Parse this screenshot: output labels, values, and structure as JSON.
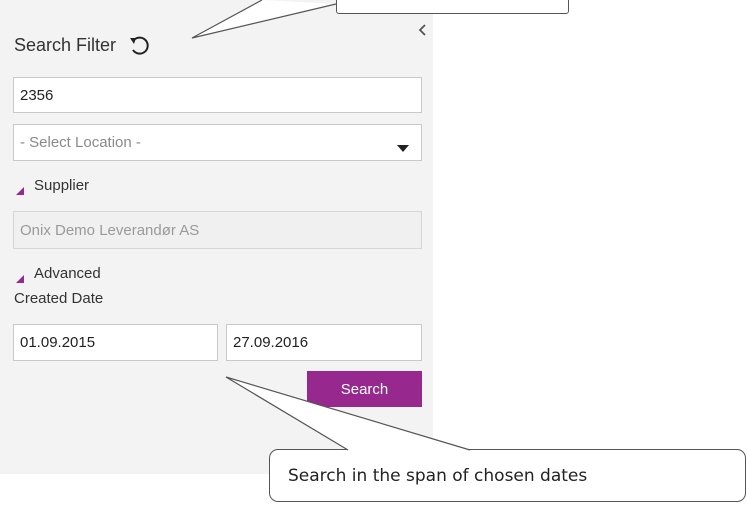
{
  "panel": {
    "title": "Search Filter",
    "icons": {
      "reset": "reset-icon",
      "collapse": "chevron-left-icon",
      "dropdown": "caret-down-icon",
      "expanded": "triangle-expanded-icon"
    },
    "search_input": {
      "value": "2356"
    },
    "location_select": {
      "selected": "- Select Location -"
    },
    "supplier_section": {
      "label": "Supplier",
      "expanded": true
    },
    "supplier_field": {
      "value": "Onix Demo Leverandør AS",
      "disabled": true
    },
    "advanced_section": {
      "label": "Advanced",
      "expanded": true
    },
    "created_date": {
      "label": "Created Date",
      "from": "01.09.2015",
      "to": "27.09.2016"
    },
    "search_button": {
      "label": "Search"
    },
    "colors": {
      "accent": "#96288e",
      "panel_bg": "#f3f3f3"
    }
  },
  "callouts": {
    "bottom": {
      "text": "Search in the span of chosen dates"
    },
    "top": {
      "text": ""
    }
  }
}
